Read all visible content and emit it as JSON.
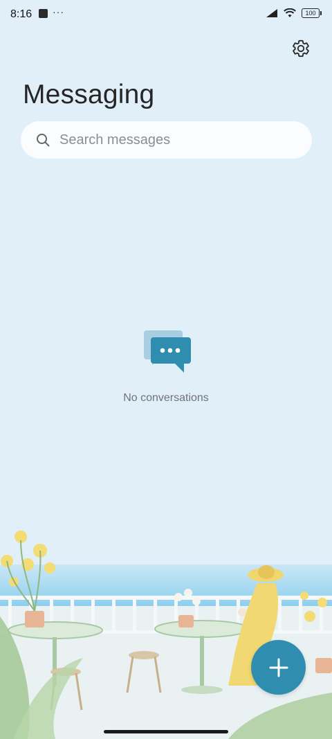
{
  "status_bar": {
    "time": "8:16",
    "more": "···",
    "battery": "100",
    "icons": [
      "app-notification-icon",
      "signal-icon",
      "wifi-icon",
      "battery-icon"
    ]
  },
  "header": {
    "title": "Messaging",
    "settings_icon": "gear-icon"
  },
  "search": {
    "placeholder": "Search messages",
    "value": "",
    "icon": "search-icon"
  },
  "empty_state": {
    "icon": "chat-bubbles-icon",
    "text": "No conversations"
  },
  "fab": {
    "icon": "plus-icon"
  },
  "colors": {
    "background": "#e1eff9",
    "accent": "#2f8eb0",
    "search_bg": "#fafcfd"
  }
}
